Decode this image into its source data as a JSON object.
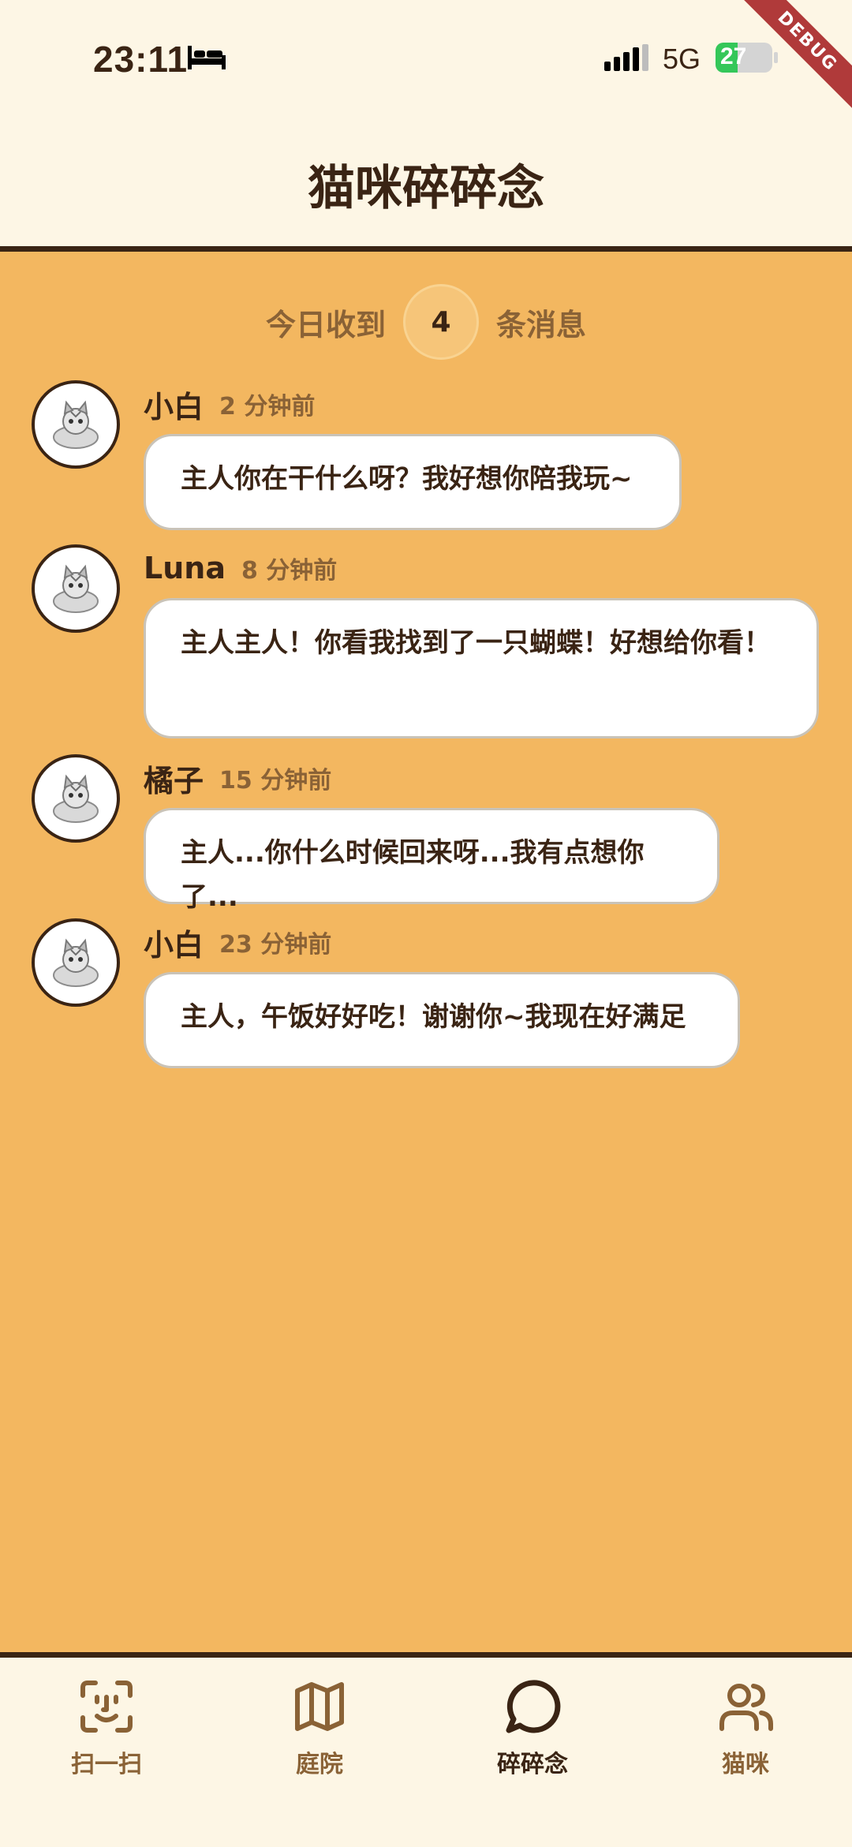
{
  "status_bar": {
    "time": "23:11",
    "network": "5G",
    "battery": "27",
    "debug_label": "DEBUG"
  },
  "header": {
    "title": "猫咪碎碎念"
  },
  "summary": {
    "prefix": "今日收到",
    "count": "4",
    "suffix": "条消息"
  },
  "messages": [
    {
      "sender": "小白",
      "time": "2 分钟前",
      "text": "主人你在干什么呀？我好想你陪我玩~"
    },
    {
      "sender": "Luna",
      "time": "8 分钟前",
      "text": "主人主人！你看我找到了一只蝴蝶！好想给你看！"
    },
    {
      "sender": "橘子",
      "time": "15 分钟前",
      "text": "主人...你什么时候回来呀...我有点想你了..."
    },
    {
      "sender": "小白",
      "time": "23 分钟前",
      "text": "主人，午饭好好吃！谢谢你~我现在好满足"
    }
  ],
  "nav": {
    "items": [
      {
        "label": "扫一扫",
        "icon": "scan-face-icon"
      },
      {
        "label": "庭院",
        "icon": "map-icon"
      },
      {
        "label": "碎碎念",
        "icon": "chat-bubble-icon"
      },
      {
        "label": "猫咪",
        "icon": "users-icon"
      }
    ],
    "active": "碎碎念"
  },
  "colors": {
    "background": "#F3B760",
    "header": "#FDF6E5",
    "text_dark": "#3A2414",
    "text_muted": "#8A6236",
    "battery_green": "#34C759"
  }
}
